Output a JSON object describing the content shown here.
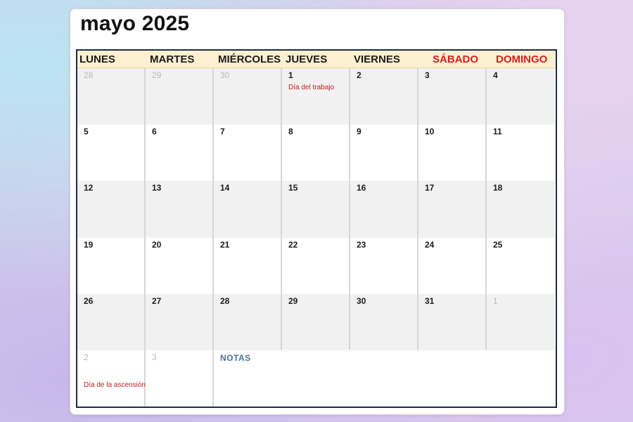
{
  "title": "mayo 2025",
  "day_names": [
    "LUNES",
    "MARTES",
    "MIÉRCOLES",
    "JUEVES",
    "VIERNES",
    "SÁBADO",
    "DOMINGO"
  ],
  "weekend_color": "#d91e1e",
  "weeks": [
    [
      {
        "n": "28",
        "other": true
      },
      {
        "n": "29",
        "other": true
      },
      {
        "n": "30",
        "other": true
      },
      {
        "n": "1",
        "holiday": "Día del trabajo"
      },
      {
        "n": "2"
      },
      {
        "n": "3"
      },
      {
        "n": "4"
      }
    ],
    [
      {
        "n": "5"
      },
      {
        "n": "6"
      },
      {
        "n": "7"
      },
      {
        "n": "8"
      },
      {
        "n": "9"
      },
      {
        "n": "10"
      },
      {
        "n": "11"
      }
    ],
    [
      {
        "n": "12"
      },
      {
        "n": "13"
      },
      {
        "n": "14"
      },
      {
        "n": "15"
      },
      {
        "n": "16"
      },
      {
        "n": "17"
      },
      {
        "n": "18"
      }
    ],
    [
      {
        "n": "19"
      },
      {
        "n": "20"
      },
      {
        "n": "21"
      },
      {
        "n": "22"
      },
      {
        "n": "23"
      },
      {
        "n": "24"
      },
      {
        "n": "25"
      }
    ],
    [
      {
        "n": "26"
      },
      {
        "n": "27"
      },
      {
        "n": "28"
      },
      {
        "n": "29"
      },
      {
        "n": "30"
      },
      {
        "n": "31"
      },
      {
        "n": "1",
        "other": true
      }
    ],
    [
      {
        "n": "2",
        "other": true,
        "holiday": "Día de la ascensión"
      },
      {
        "n": "3",
        "other": true
      }
    ]
  ],
  "notes_label": "NOTAS",
  "colors": {
    "holiday": "#c41a1a",
    "notes": "#4b6f99",
    "header_bg": "#fdf0d0",
    "border": "#1f2b44"
  }
}
